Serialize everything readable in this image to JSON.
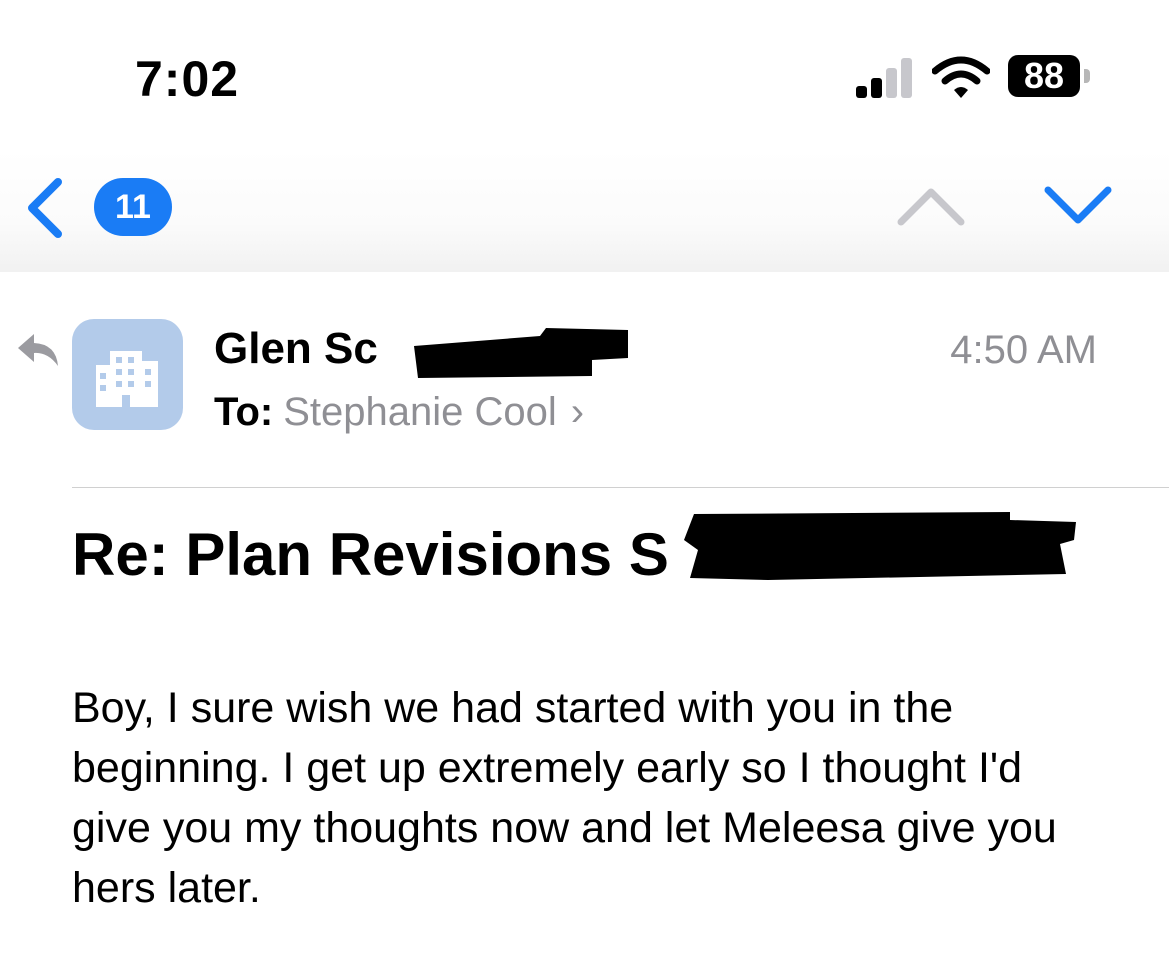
{
  "status_bar": {
    "time": "7:02",
    "battery_level": "88",
    "signal_bars_active": 2,
    "signal_bars_total": 4
  },
  "nav": {
    "back_icon": "chevron-left-icon",
    "unread_count": "11",
    "prev_icon": "chevron-up-icon",
    "next_icon": "chevron-down-icon",
    "accent_color": "#1a7cf5",
    "disabled_color": "#c7c7cc"
  },
  "message": {
    "sender": "Glen Sc",
    "recipient_label": "To:",
    "recipient": "Stephanie Cool",
    "time": "4:50 AM",
    "subject": "Re: Plan Revisions S",
    "body": "Boy, I sure wish we had started with you in the beginning. I get up extremely early so I thought I'd give you my thoughts now and let Meleesa give you hers later.",
    "avatar_icon": "building-icon",
    "avatar_color": "#b3cbea",
    "reply_icon": "reply-arrow-icon"
  }
}
